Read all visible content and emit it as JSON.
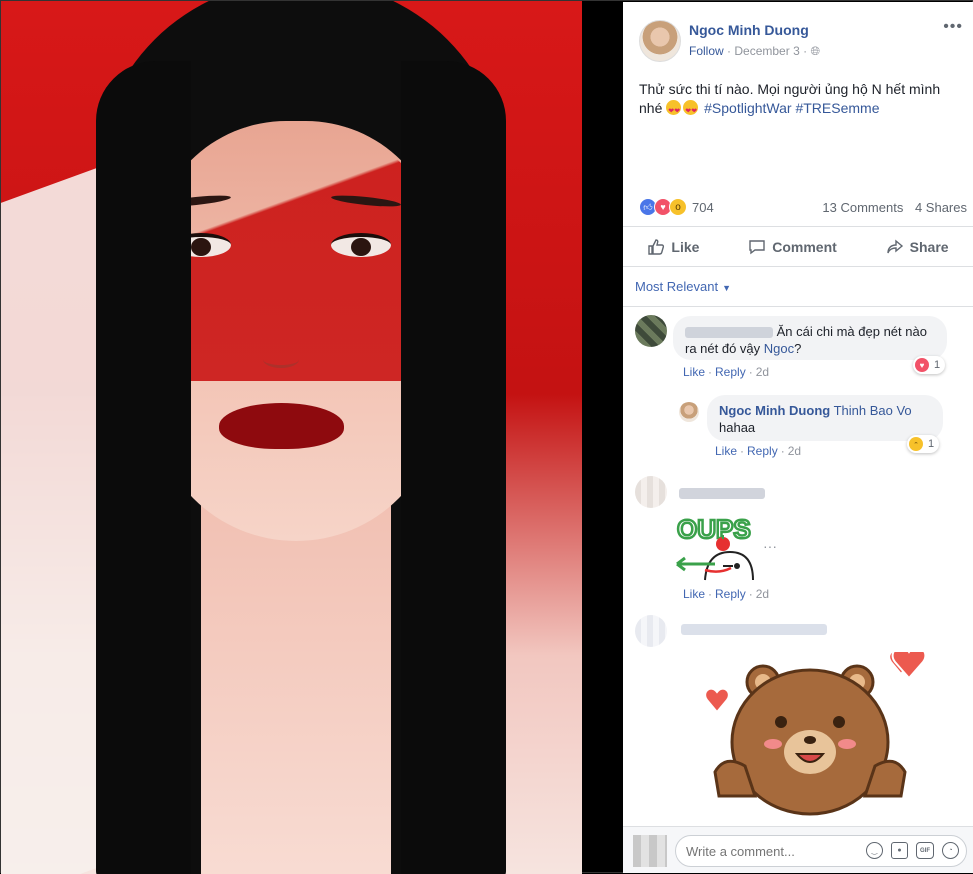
{
  "post": {
    "author": "Ngoc Minh Duong",
    "follow": "Follow",
    "date": "December 3",
    "privacy_icon": "globe-icon",
    "more": "•••",
    "text_plain": "Thử sức thi tí nào. Mọi người ủng hộ N hết mình nhé",
    "hashtag1": "#SpotlightWar",
    "hashtag2": "#TRESemme",
    "reaction_count": "704",
    "comments_count": "13 Comments",
    "shares_count": "4 Shares"
  },
  "actions": {
    "like": "Like",
    "comment": "Comment",
    "share": "Share"
  },
  "sort": {
    "label": "Most Relevant"
  },
  "comments": [
    {
      "text_before": "Ăn cái chi mà đẹp nét nào ra nét đó vậy ",
      "mention": "Ngoc",
      "text_after": "?",
      "like": "Like",
      "reply": "Reply",
      "time": "2d",
      "reaction_count": "1"
    },
    {
      "name": "Ngoc Minh Duong",
      "mention": "Thinh Bao Vo",
      "text": "hahaa",
      "like": "Like",
      "reply": "Reply",
      "time": "2d",
      "reaction_count": "1"
    },
    {
      "sticker_text": "OUPS",
      "like": "Like",
      "reply": "Reply",
      "time": "2d",
      "more": "···"
    }
  ],
  "composer": {
    "placeholder": "Write a comment..."
  },
  "colors": {
    "link": "#365899",
    "like_blue": "#4a76e8",
    "love_red": "#f25268",
    "text": "#1d2129",
    "muted": "#90949c"
  }
}
